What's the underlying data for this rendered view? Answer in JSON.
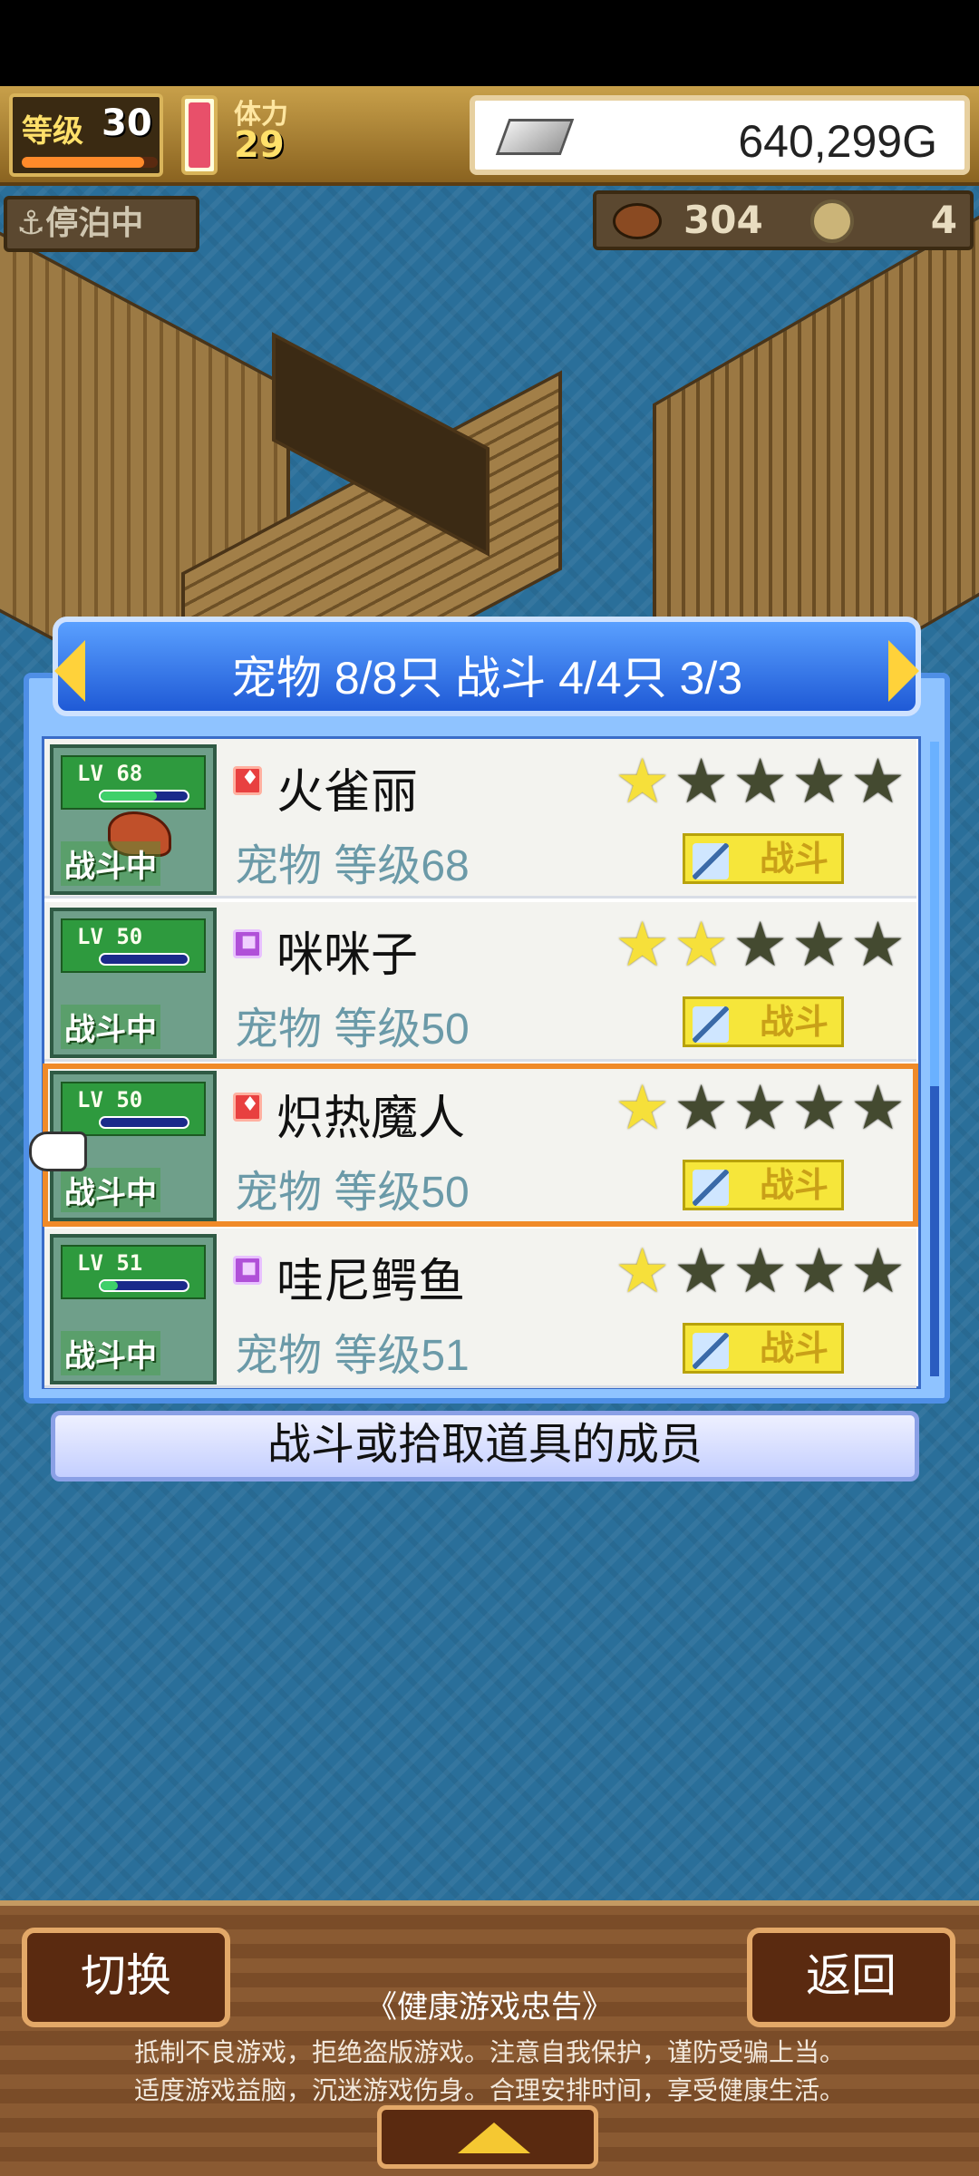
{
  "hud": {
    "level_label": "等级",
    "level_value": "30",
    "level_progress": 0.9,
    "stamina_label": "体力",
    "stamina_value": "29",
    "gold": "640,299G",
    "dock_status": "⚓停泊中",
    "food_value": "304",
    "coin_value": "4"
  },
  "panel": {
    "title": "宠物 8/8只 战斗 4/4只  3/3"
  },
  "pets": [
    {
      "lv_label": "LV 68",
      "name": "火雀丽",
      "sub": "宠物 等级68",
      "element": "fire",
      "stars": 1,
      "status": "战斗中",
      "battle_label": "战斗",
      "hp_fill": 0.65
    },
    {
      "lv_label": "LV 50",
      "name": "咪咪子",
      "sub": "宠物 等级50",
      "element": "psy",
      "stars": 2,
      "status": "战斗中",
      "battle_label": "战斗",
      "hp_fill": 0.0
    },
    {
      "lv_label": "LV 50",
      "name": "炽热魔人",
      "sub": "宠物 等级50",
      "element": "fire",
      "stars": 1,
      "status": "战斗中",
      "battle_label": "战斗",
      "hp_fill": 0.0
    },
    {
      "lv_label": "LV 51",
      "name": "哇尼鳄鱼",
      "sub": "宠物 等级51",
      "element": "psy",
      "stars": 1,
      "status": "战斗中",
      "battle_label": "战斗",
      "hp_fill": 0.2
    }
  ],
  "info": {
    "text": "战斗或拾取道具的成员"
  },
  "bottom": {
    "switch_label": "切换",
    "back_label": "返回",
    "health_title": "《健康游戏忠告》",
    "health_line1": "抵制不良游戏，拒绝盗版游戏。注意自我保护，谨防受骗上当。",
    "health_line2": "适度游戏益脑，沉迷游戏伤身。合理安排时间，享受健康生活。"
  }
}
